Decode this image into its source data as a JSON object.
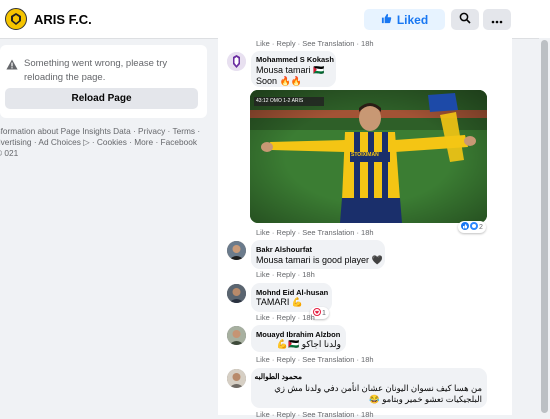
{
  "header": {
    "page_name": "ARIS F.C.",
    "liked_label": "Liked",
    "logo_icon": "aris-crest-icon",
    "brand_color": "#1877f2"
  },
  "sidebar": {
    "error_message": "Something went wrong, please try reloading the page.",
    "reload_label": "Reload Page",
    "footer_links": "nformation about Page Insights Data · Privacy · Terms · dvertising · Ad Choices ▷ · Cookies · More · Facebook © 021"
  },
  "comments": [
    {
      "actions_above": "Like · Reply · See Translation · 18h"
    },
    {
      "author": "Mohammed S Kokash",
      "line1": "Mousa tamari 🇵🇸",
      "line2": "Soon 🔥🔥",
      "actions": "Like · Reply · See Translation · 18h",
      "reaction_count": "2",
      "photo": {
        "score_text": "43:12  OMO  1-2  ARIS",
        "shirt_text": "STOIXIMAN"
      }
    },
    {
      "author": "Bakr Alshourfat",
      "text": "Mousa tamari is good player 🖤",
      "actions": "Like · Reply · 18h"
    },
    {
      "author": "Mohnd Eid Al-husan",
      "text": "TAMARI 💪",
      "actions": "Like · Reply · 18h",
      "reaction_count": "1"
    },
    {
      "author": "Mouayd Ibrahim Alzbon",
      "text": "ولدنا اجاكو 🇵🇸💪",
      "actions": "Like · Reply · See Translation · 18h"
    },
    {
      "author": "محمود الطوالبه",
      "line1": "من هسا كيف نسوان اليونان عشان انأمن دفي ولدنا مش زي",
      "line2": "البلجيكيات تعشو خمير وبتامو 😂",
      "actions": "Like · Reply · See Translation · 18h"
    }
  ]
}
